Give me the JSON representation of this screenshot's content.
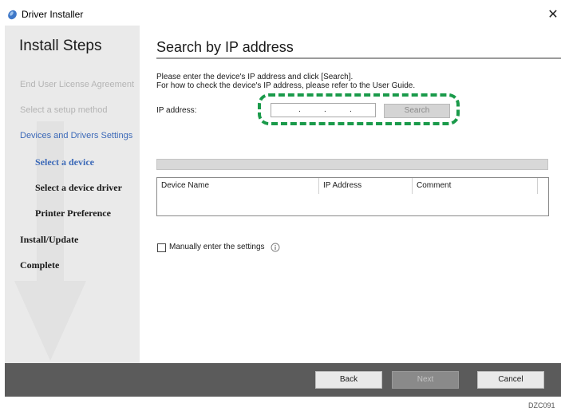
{
  "window": {
    "title": "Driver Installer",
    "close_glyph": "✕"
  },
  "sidebar": {
    "title": "Install Steps",
    "steps": [
      {
        "label": "End User License Agreement",
        "state": "disabled"
      },
      {
        "label": "Select a setup method",
        "state": "disabled"
      },
      {
        "label": "Devices and Drivers Settings",
        "state": "current-section"
      },
      {
        "label": "Select a device",
        "state": "current-sub"
      },
      {
        "label": "Select a device driver",
        "state": "sub"
      },
      {
        "label": "Printer Preference",
        "state": "sub"
      },
      {
        "label": "Install/Update",
        "state": "main"
      },
      {
        "label": "Complete",
        "state": "main"
      }
    ]
  },
  "main": {
    "page_title": "Search by IP address",
    "instruction_line1": "Please enter the device's IP address and click [Search].",
    "instruction_line2": "For how to check the device's IP address, please refer to the User Guide.",
    "ip_label": "IP address:",
    "ip_value": "",
    "search_label": "Search",
    "table": {
      "columns": [
        "Device Name",
        "IP Address",
        "Comment"
      ],
      "rows": []
    },
    "manual_label": "Manually enter the settings",
    "manual_checked": false
  },
  "footer": {
    "back_label": "Back",
    "next_label": "Next",
    "cancel_label": "Cancel"
  },
  "figure_id": "DZC091",
  "colors": {
    "accent_blue": "#3d6ab8",
    "highlight_green": "#1a9a4a",
    "footer_bg": "#5b5b5b",
    "sidebar_bg": "#eaeaea"
  },
  "icons": {
    "app": "driver-installer-icon",
    "close": "close-icon",
    "info": "info-icon"
  }
}
